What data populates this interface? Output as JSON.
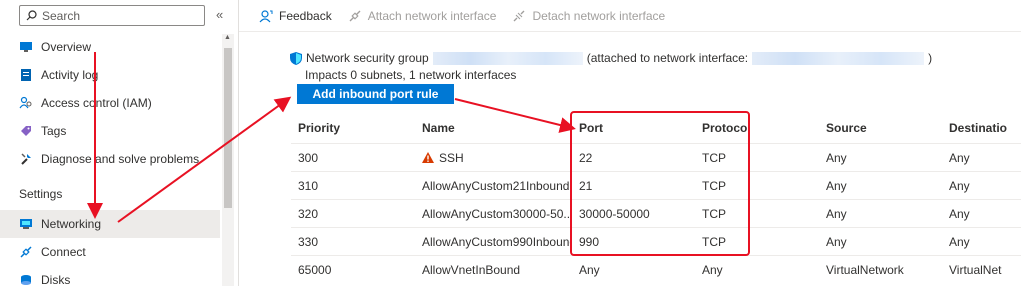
{
  "sidebar": {
    "search_placeholder": "Search",
    "collapse_glyph": "«",
    "items": [
      {
        "label": "Overview",
        "icon": "overview-icon"
      },
      {
        "label": "Activity log",
        "icon": "activity-log-icon"
      },
      {
        "label": "Access control (IAM)",
        "icon": "iam-icon"
      },
      {
        "label": "Tags",
        "icon": "tag-icon"
      },
      {
        "label": "Diagnose and solve problems",
        "icon": "wrench-icon"
      }
    ],
    "section_header": "Settings",
    "settings_items": [
      {
        "label": "Networking",
        "icon": "networking-icon",
        "active": true
      },
      {
        "label": "Connect",
        "icon": "connect-icon"
      },
      {
        "label": "Disks",
        "icon": "disks-icon"
      }
    ]
  },
  "toolbar": {
    "feedback": "Feedback",
    "attach": "Attach network interface",
    "detach": "Detach network interface"
  },
  "nsg": {
    "prefix": "Network security group",
    "attached_prefix": "(attached to network interface:",
    "attached_suffix": ")",
    "impacts": "Impacts 0 subnets, 1 network interfaces",
    "add_button": "Add inbound port rule"
  },
  "table": {
    "headers": [
      "Priority",
      "Name",
      "Port",
      "Protocol",
      "Source",
      "Destinatio"
    ],
    "rows": [
      {
        "priority": "300",
        "name": "SSH",
        "warning": true,
        "port": "22",
        "protocol": "TCP",
        "source": "Any",
        "destination": "Any"
      },
      {
        "priority": "310",
        "name": "AllowAnyCustom21Inbound",
        "warning": false,
        "port": "21",
        "protocol": "TCP",
        "source": "Any",
        "destination": "Any"
      },
      {
        "priority": "320",
        "name": "AllowAnyCustom30000-50...",
        "warning": false,
        "port": "30000-50000",
        "protocol": "TCP",
        "source": "Any",
        "destination": "Any"
      },
      {
        "priority": "330",
        "name": "AllowAnyCustom990Inbound",
        "warning": false,
        "port": "990",
        "protocol": "TCP",
        "source": "Any",
        "destination": "Any"
      },
      {
        "priority": "65000",
        "name": "AllowVnetInBound",
        "warning": false,
        "port": "Any",
        "protocol": "Any",
        "source": "VirtualNetwork",
        "destination": "VirtualNet"
      }
    ]
  },
  "colors": {
    "accent": "#0078d4",
    "annotation_red": "#e81123",
    "warning": "#d83b01"
  }
}
